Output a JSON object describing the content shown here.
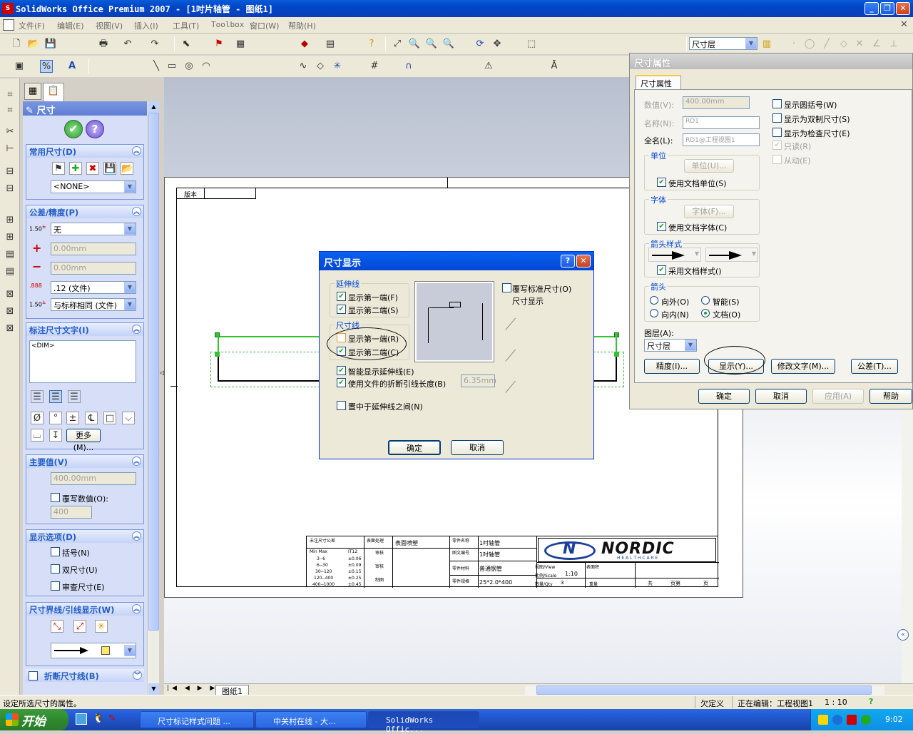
{
  "window": {
    "title": "SolidWorks Office Premium 2007 - [1吋片轴管 - 图纸1]"
  },
  "menu": [
    "文件(F)",
    "编辑(E)",
    "视图(V)",
    "插入(I)",
    "工具(T)",
    "Toolbox",
    "窗口(W)",
    "帮助(H)"
  ],
  "toolbar": {
    "layer_select": "尺寸层"
  },
  "left_tabs": {
    "title": "尺寸"
  },
  "pm": {
    "common": {
      "title": "常用尺寸(D)",
      "style": "<NONE>"
    },
    "tolerance": {
      "title": "公差/精度(P)",
      "type": "无",
      "plus": "0.00mm",
      "minus": "0.00mm",
      "precision": ".12 (文件)",
      "tol_precision": "与标称相同 (文件)",
      "prefix1": "1.50",
      "prefix2": "1.50"
    },
    "dimtext": {
      "title": "标注尺寸文字(I)",
      "text": "<DIM>",
      "more": "更多(M)..."
    },
    "primary": {
      "title": "主要值(V)",
      "value": "400.00mm",
      "override": "覆写数值(O):",
      "override_val": "400"
    },
    "display": {
      "title": "显示选项(D)",
      "opt1": "括号(N)",
      "opt2": "双尺寸(U)",
      "opt3": "审查尺寸(E)"
    },
    "leader": {
      "title": "尺寸界线/引线显示(W)"
    },
    "break": {
      "title": "折断尺寸线(B)"
    }
  },
  "drawing": {
    "rev": "版本",
    "sheet_tab": "图纸1",
    "logo": "NORDIC",
    "logo_sub": "H E A L T H C A R E",
    "tb": {
      "r1c1": "未注尺寸公差",
      "r1c2": "表面处理",
      "r1c3": "表面喷塑",
      "r1c4": "零件名称",
      "r1c5": "1吋轴管",
      "r2c1": "Min  Max",
      "r2c2": "IT12",
      "r2c3": "审核",
      "r2c4": "图文编号",
      "r2c5": "1吋轴管",
      "r3c1": "3--6",
      "r3c2": "±0.06",
      "r3c3": "",
      "r4c1": "6--30",
      "r4c2": "±0.09",
      "r4c3": "审核",
      "r4c4": "零件材料",
      "r4c5": "普通钢管",
      "r4c6": "视图/View",
      "r4c7": "表面积",
      "r5c1": "30--120",
      "r5c2": "±0.15",
      "r5c6": "比例/Scale",
      "r5c7": "1:10",
      "r6c1": "120--400",
      "r6c2": "±0.25",
      "r6c3": "制图",
      "r6c4": "零件规格",
      "r6c5": "25*2.0*400",
      "r6c6": "数量/Qty",
      "r6c7": "3",
      "r6c8": "重量",
      "r7c1": "400--1000",
      "r7c2": "±0.45",
      "r7c9": "共",
      "r7c10": "页第",
      "r7c11": "页"
    }
  },
  "dlg_display": {
    "title": "尺寸显示",
    "ext_group": "延伸线",
    "ext1": "显示第一端(F)",
    "ext2": "显示第二端(S)",
    "dim_group": "尺寸线",
    "dim1": "显示第一端(R)",
    "dim2": "显示第二端(C)",
    "override": "覆写标准尺寸(O)",
    "override_sub": "尺寸显示",
    "smart": "智能显示延伸线(E)",
    "break_len": "使用文件的折断引线长度(B)",
    "break_val": "6.35mm",
    "center": "置中于延伸线之间(N)",
    "ok": "确定",
    "cancel": "取消"
  },
  "dlg_props": {
    "title": "尺寸属性",
    "tab": "尺寸属性",
    "value_label": "数值(V):",
    "value": "400.00mm",
    "name_label": "名称(N):",
    "name": "RD1",
    "full_label": "全名(L):",
    "full": "RD1@工程视图1",
    "unit_group": "单位",
    "unit_btn": "单位(U)...",
    "unit_chk": "使用文档单位(S)",
    "font_group": "字体",
    "font_btn": "字体(F)...",
    "font_chk": "使用文档字体(C)",
    "arrow_style_group": "箭头样式",
    "arrow_style_chk": "采用文档样式()",
    "arrow_group": "箭头",
    "out": "向外(O)",
    "smart": "智能(S)",
    "in": "向内(N)",
    "doc": "文档(O)",
    "layer_label": "图层(A):",
    "layer": "尺寸层",
    "c1": "显示圆括号(W)",
    "c2": "显示为双制尺寸(S)",
    "c3": "显示为检查尺寸(E)",
    "c4": "只读(R)",
    "c5": "从动(E)",
    "precision": "精度(I)...",
    "display": "显示(Y)...",
    "modify": "修改文字(M)...",
    "tolerance": "公差(T)...",
    "ok": "确定",
    "cancel": "取消",
    "apply": "应用(A)",
    "help": "帮助"
  },
  "status": {
    "text": "设定所选尺寸的属性。",
    "defined": "欠定义",
    "editing": "正在编辑：工程视图1",
    "scale": "1 : 10"
  },
  "taskbar": {
    "start": "开始",
    "tasks": [
      "尺寸标记样式问题 ...",
      "中关村在线 - 大...",
      "SolidWorks Offic..."
    ],
    "time": "9:02"
  }
}
